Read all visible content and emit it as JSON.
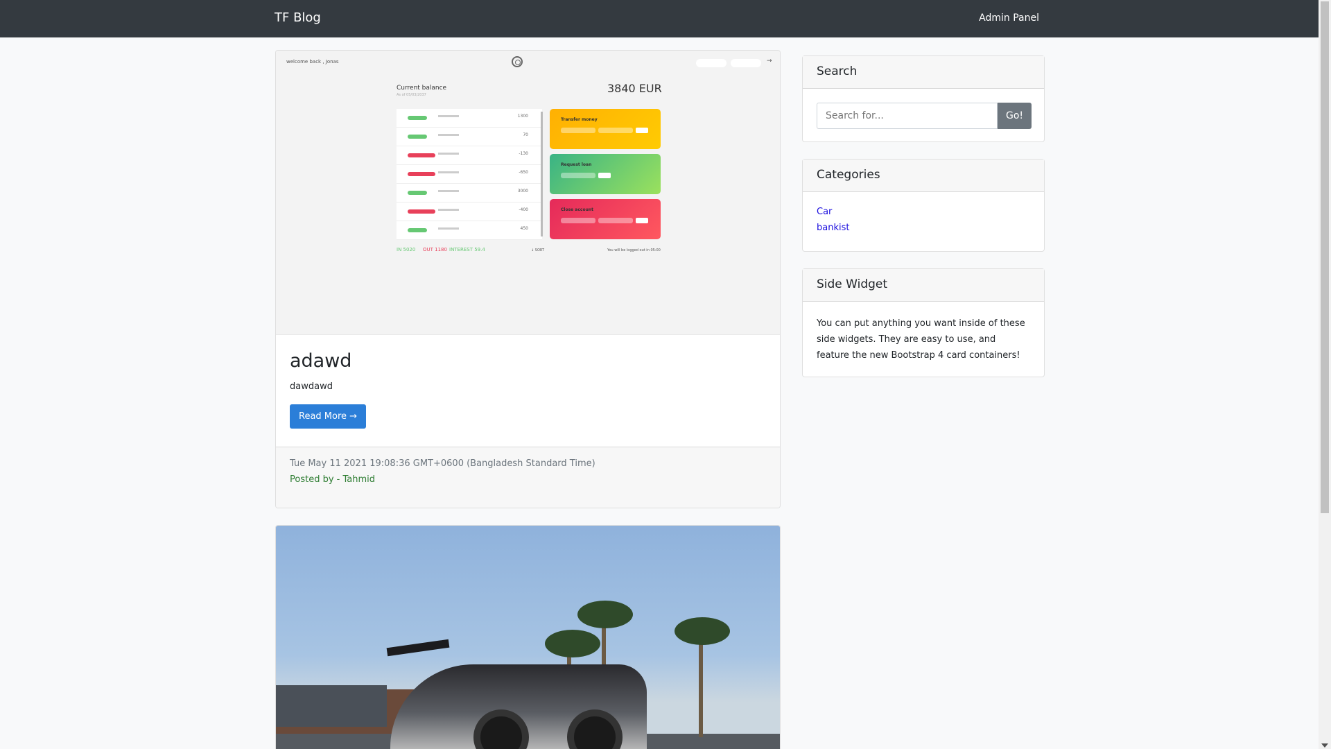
{
  "navbar": {
    "brand": "TF Blog",
    "admin_link": "Admin Panel"
  },
  "posts": [
    {
      "title": "adawd",
      "excerpt": "dawdawd",
      "read_more": "Read More →",
      "date": "Tue May 11 2021 19:08:36 GMT+0600 (Bangladesh Standard Time)",
      "author": "Posted by - Tahmid",
      "image": {
        "greeting": "welcome back , Jonas",
        "balance_label": "Current balance",
        "balance_sub": "As of 05/03/2037",
        "balance_amount": "3840 EUR",
        "movements": [
          {
            "type": "deposit",
            "value": "1300"
          },
          {
            "type": "deposit",
            "value": "70"
          },
          {
            "type": "withdrawal",
            "value": "-130"
          },
          {
            "type": "withdrawal",
            "value": "-650"
          },
          {
            "type": "deposit",
            "value": "3000"
          },
          {
            "type": "withdrawal",
            "value": "-400"
          },
          {
            "type": "deposit",
            "value": "450"
          }
        ],
        "ops": {
          "transfer": "Transfer money",
          "loan": "Request loan",
          "close": "Close account"
        },
        "summary_in": "IN 5020",
        "summary_out": "OUT 1180",
        "summary_interest": "INTEREST 59.4",
        "sort": "↓ SORT",
        "logout": "You will be logged out in 05:00"
      }
    }
  ],
  "sidebar": {
    "search": {
      "title": "Search",
      "placeholder": "Search for...",
      "button": "Go!"
    },
    "categories": {
      "title": "Categories",
      "items": [
        "Car",
        "bankist"
      ]
    },
    "widget": {
      "title": "Side Widget",
      "text": "You can put anything you want inside of these side widgets. They are easy to use, and feature the new Bootstrap 4 card containers!"
    }
  }
}
